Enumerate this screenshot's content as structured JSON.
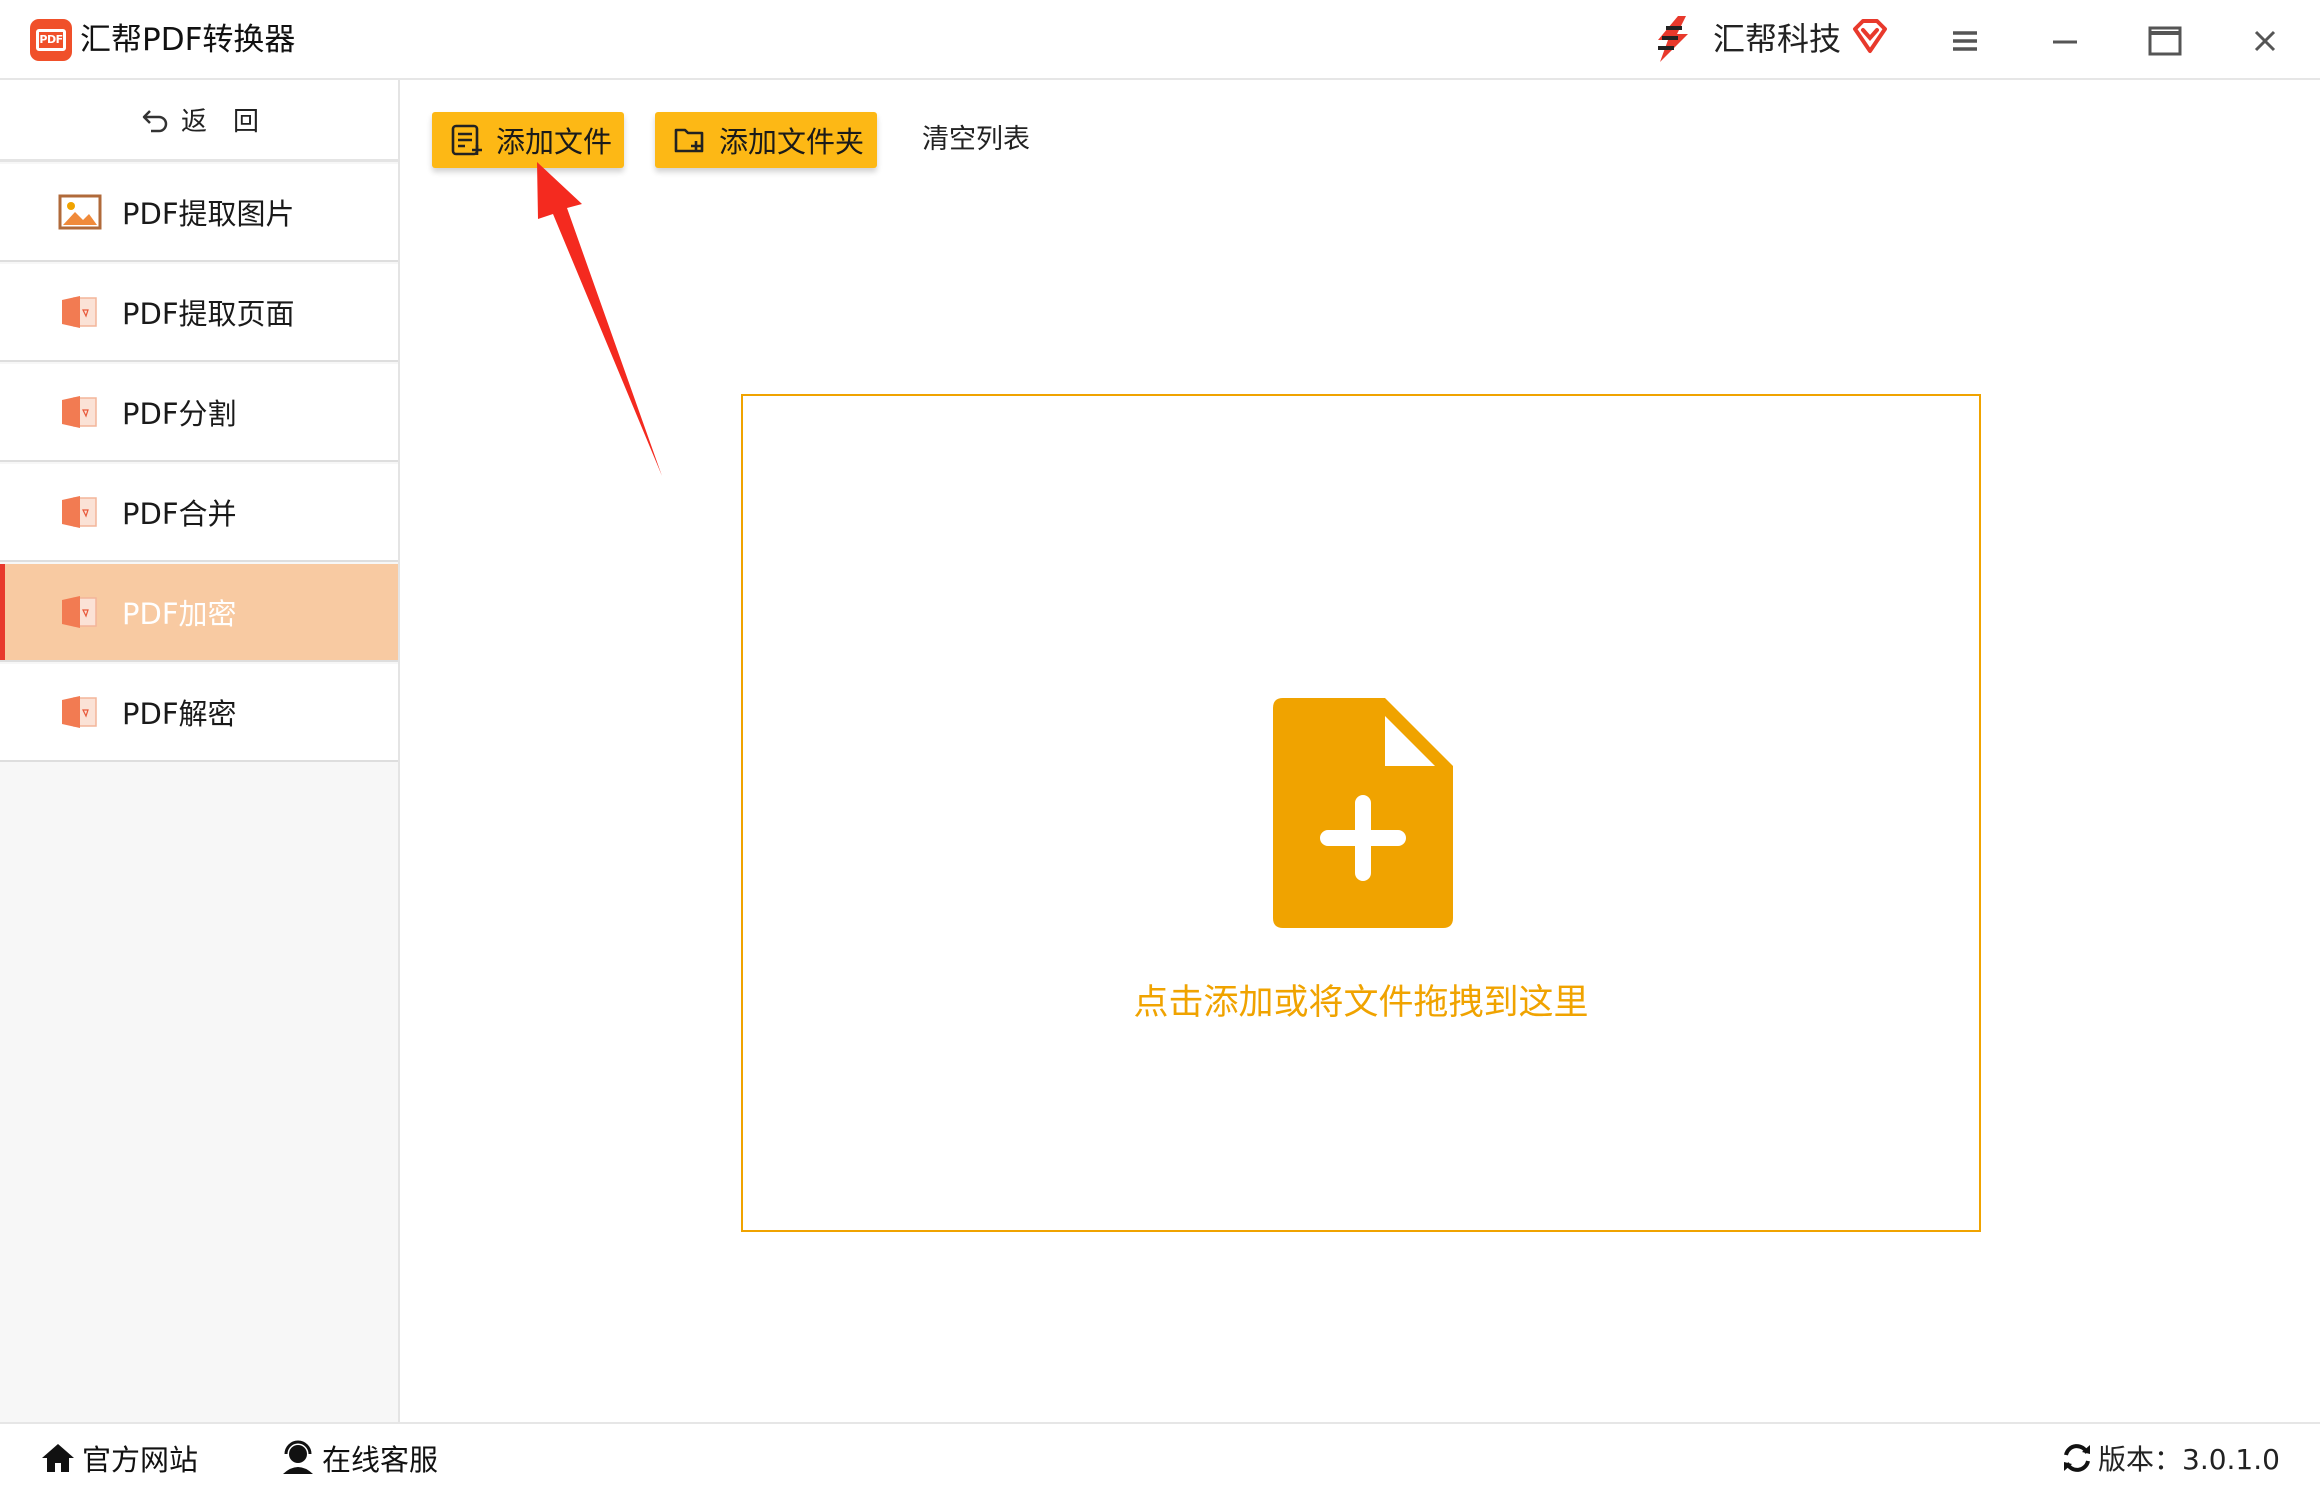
{
  "app": {
    "title": "汇帮PDF转换器",
    "brand_name": "汇帮科技"
  },
  "sidebar": {
    "back_label": "返回",
    "items": [
      {
        "label": "PDF提取图片",
        "icon": "image-icon",
        "active": false
      },
      {
        "label": "PDF提取页面",
        "icon": "pdf-file-icon",
        "active": false
      },
      {
        "label": "PDF分割",
        "icon": "pdf-file-icon",
        "active": false
      },
      {
        "label": "PDF合并",
        "icon": "pdf-file-icon",
        "active": false
      },
      {
        "label": "PDF加密",
        "icon": "pdf-file-icon",
        "active": true
      },
      {
        "label": "PDF解密",
        "icon": "pdf-file-icon",
        "active": false
      }
    ]
  },
  "toolbar": {
    "add_file": "添加文件",
    "add_folder": "添加文件夹",
    "clear_list": "清空列表"
  },
  "dropzone": {
    "hint": "点击添加或将文件拖拽到这里"
  },
  "footer": {
    "website": "官方网站",
    "support": "在线客服",
    "version": "版本：3.0.1.0"
  },
  "colors": {
    "accent": "#f0a300",
    "button": "#fdb815",
    "active_item": "#f8caa2",
    "active_marker": "#e8392c",
    "annotation_arrow": "#f42a1f"
  }
}
